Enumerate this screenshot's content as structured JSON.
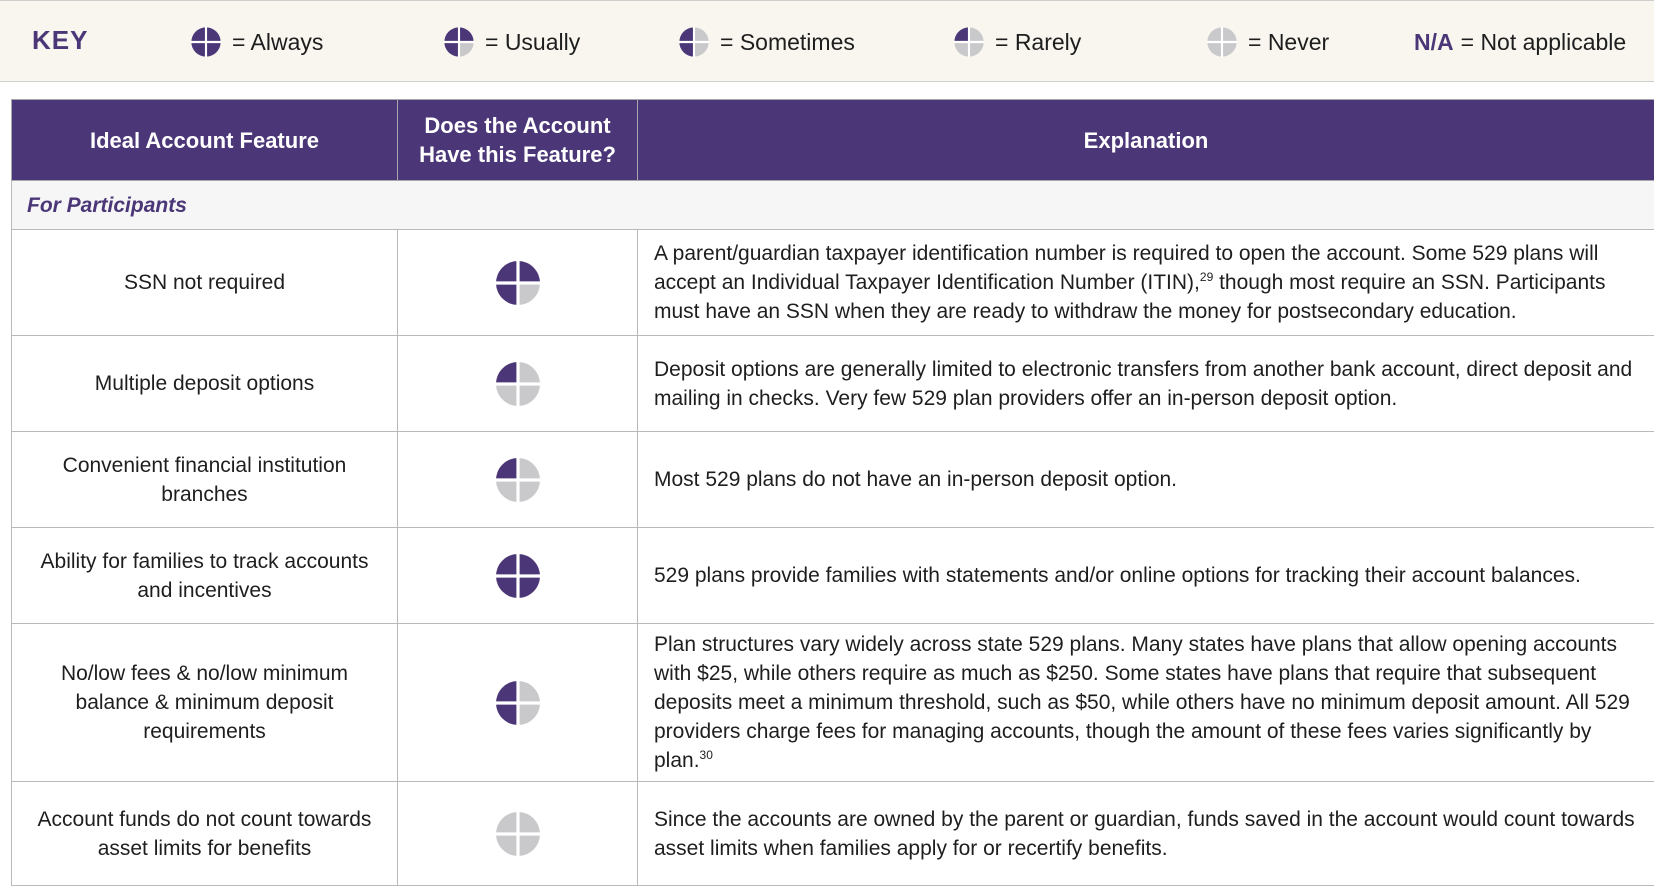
{
  "colors": {
    "brand_purple": "#4b3778",
    "never_gray": "#c9c9cb",
    "key_background": "#f8f6ee"
  },
  "key": {
    "title": "KEY",
    "items": [
      {
        "icon": "quarter-circle-always-icon",
        "label": "= Always",
        "filled_quarters": 4
      },
      {
        "icon": "quarter-circle-usually-icon",
        "label": "= Usually",
        "filled_quarters": 3
      },
      {
        "icon": "quarter-circle-sometimes-icon",
        "label": "= Sometimes",
        "filled_quarters": 2
      },
      {
        "icon": "quarter-circle-rarely-icon",
        "label": "= Rarely",
        "filled_quarters": 1
      },
      {
        "icon": "quarter-circle-never-icon",
        "label": "= Never",
        "filled_quarters": 0
      }
    ],
    "na": {
      "abbr": "N/A",
      "label": "= Not applicable"
    }
  },
  "table": {
    "headers": {
      "feature": "Ideal Account Feature",
      "has_line1": "Does the Account",
      "has_line2": "Have this Feature?",
      "explanation": "Explanation"
    },
    "section": "For Participants",
    "rows": [
      {
        "feature": "SSN not required",
        "rating": "Usually",
        "explanation": "A parent/guardian taxpayer identification number is required to open the account. Some 529 plans will accept an Individual Taxpayer Identification Number (ITIN),",
        "footnote": "29",
        "explanation_cont": " though most require an SSN. Participants must have an SSN when they are ready to withdraw the money for postsecondary education."
      },
      {
        "feature": "Multiple deposit options",
        "rating": "Rarely",
        "explanation": "Deposit options are generally limited to electronic transfers from another bank account, direct deposit and mailing in checks. Very few 529 plan providers offer an in-person deposit option."
      },
      {
        "feature": "Convenient financial institution branches",
        "rating": "Rarely",
        "explanation": "Most 529 plans do not have an in-person deposit option."
      },
      {
        "feature": "Ability for families to track accounts and incentives",
        "rating": "Always",
        "explanation": "529 plans provide families with statements and/or online options for tracking their account balances."
      },
      {
        "feature": "No/low fees & no/low minimum balance & minimum deposit requirements",
        "rating": "Sometimes",
        "explanation": "Plan structures vary widely across state 529 plans. Many states have plans that allow opening accounts with $25, while others require as much as $250. Some states have plans that require that subsequent deposits meet a minimum threshold, such as $50, while others have no minimum deposit amount.  All 529 providers charge fees for managing accounts, though the amount of these fees varies significantly by plan.",
        "footnote": "30"
      },
      {
        "feature": "Account funds do not count towards asset limits for benefits",
        "rating": "Never",
        "explanation": "Since the accounts are owned by the parent or guardian, funds saved in the account would count towards asset limits when families apply for or recertify benefits."
      }
    ]
  }
}
